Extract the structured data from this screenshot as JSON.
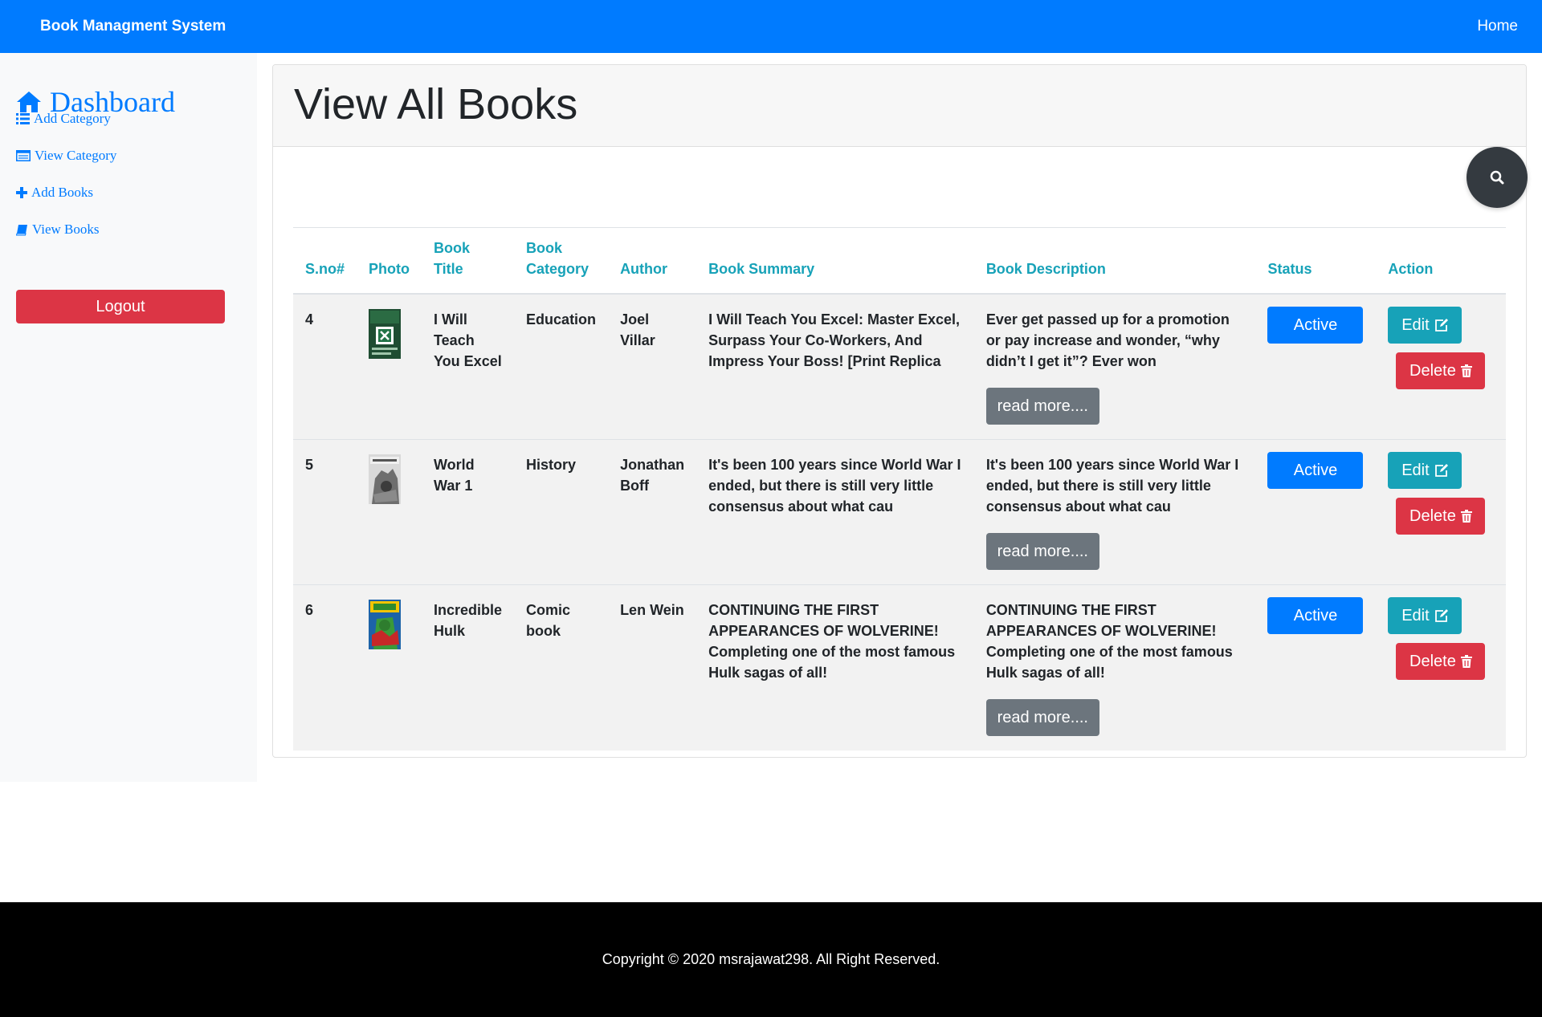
{
  "navbar": {
    "brand": "Book Managment System",
    "home": "Home"
  },
  "sidebar": {
    "dashboard": "Dashboard",
    "links": [
      {
        "label": "Add Category",
        "icon": "list-icon"
      },
      {
        "label": "View Category",
        "icon": "table-icon"
      },
      {
        "label": "Add Books",
        "icon": "plus-icon"
      },
      {
        "label": "View Books",
        "icon": "book-icon"
      }
    ],
    "logout": "Logout"
  },
  "main": {
    "title": "View All Books",
    "table": {
      "headers": [
        "S.no#",
        "Photo",
        "Book Title",
        "Book Category",
        "Author",
        "Book Summary",
        "Book Description",
        "Status",
        "Action"
      ],
      "rows": [
        {
          "sno": "4",
          "title": "I Will Teach You Excel",
          "category": "Education",
          "author": "Joel Villar",
          "summary": "I Will Teach You Excel: Master Excel, Surpass Your Co-Workers, And Impress Your Boss! [Print Replica",
          "description": "Ever get passed up for a promotion or pay increase and wonder, “why didn’t I get it”? Ever won",
          "status": "Active"
        },
        {
          "sno": "5",
          "title": "World War 1",
          "category": "History",
          "author": "Jonathan Boff",
          "summary": "It's been 100 years since World War I ended, but there is still very little consensus about what cau",
          "description": "It's been 100 years since World War I ended, but there is still very little consensus about what cau",
          "status": "Active"
        },
        {
          "sno": "6",
          "title": "Incredible Hulk",
          "category": "Comic book",
          "author": "Len Wein",
          "summary": "CONTINUING THE FIRST APPEARANCES OF WOLVERINE! Completing one of the most famous Hulk sagas of all!",
          "description": "CONTINUING THE FIRST APPEARANCES OF WOLVERINE! Completing one of the most famous Hulk sagas of all!",
          "status": "Active"
        }
      ],
      "read_more": "read more....",
      "edit": "Edit",
      "delete": "Delete"
    }
  },
  "footer": {
    "copyright": "Copyright © 2020 msrajawat298. All Right Reserved."
  },
  "colors": {
    "primary": "#007bff",
    "info": "#17a2b8",
    "danger": "#dc3545",
    "secondary": "#6c757d",
    "dark": "#343a40"
  }
}
